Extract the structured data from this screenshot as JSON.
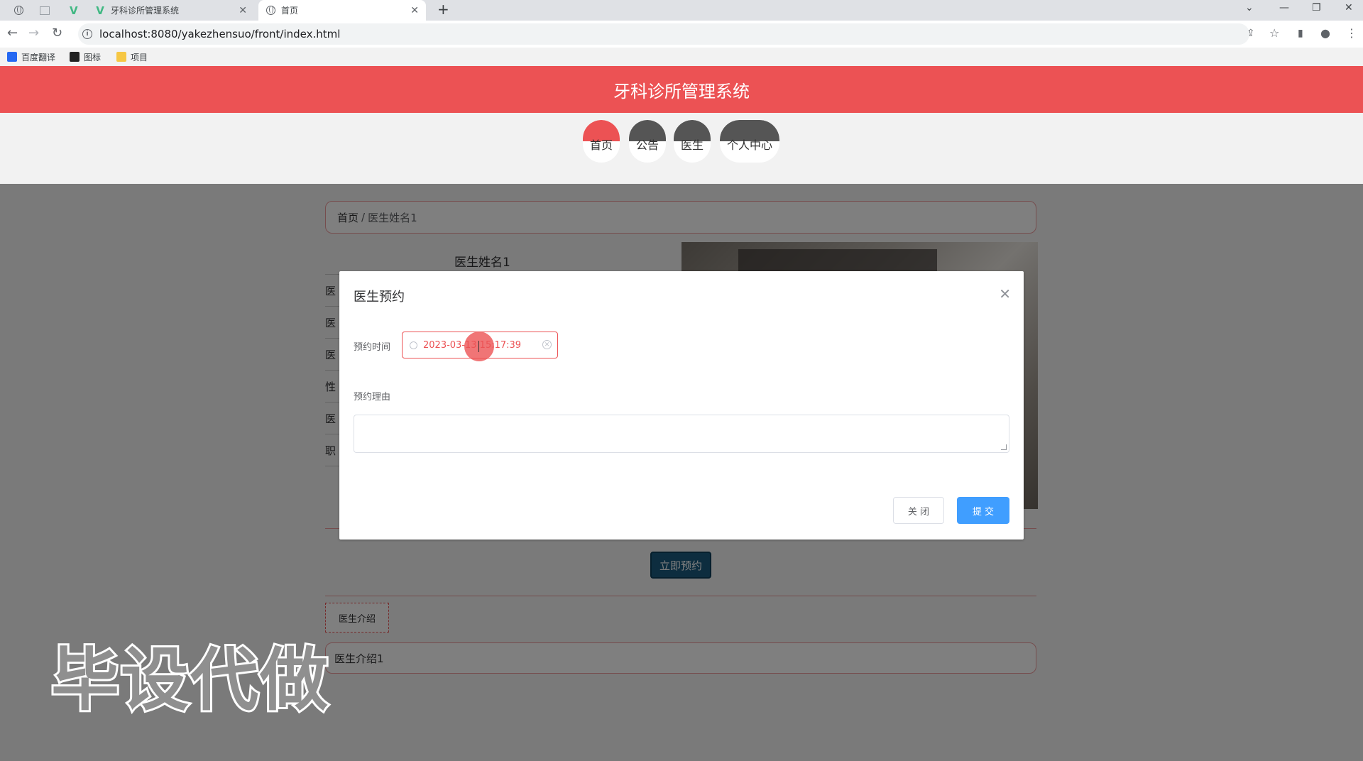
{
  "browser": {
    "tabs": [
      {
        "title": "牙科诊所管理系统"
      },
      {
        "title": "首页"
      }
    ],
    "url": "localhost:8080/yakezhensuo/front/index.html",
    "bookmarks": [
      "百度翻译",
      "图标",
      "项目"
    ]
  },
  "app": {
    "title": "牙科诊所管理系统",
    "menu": [
      {
        "label": "首页",
        "active": true
      },
      {
        "label": "公告"
      },
      {
        "label": "医生"
      },
      {
        "label": "个人中心"
      }
    ]
  },
  "breadcrumb": {
    "home": "首页",
    "separator": "/",
    "current": "医生姓名1"
  },
  "doctor": {
    "name": "医生姓名1",
    "field_labels_partial": [
      "医",
      "医",
      "医",
      "性",
      "医",
      "职"
    ],
    "book_button": "立即预约",
    "intro_tab": "医生介绍",
    "intro_text": "医生介绍1"
  },
  "dialog": {
    "title": "医生预约",
    "time_label": "预约时间",
    "time_value": "2023-03-13 15:17:39",
    "reason_label": "预约理由",
    "reason_value": "",
    "close_button": "关 闭",
    "submit_button": "提 交"
  },
  "watermark": "毕设代做",
  "colors": {
    "brand": "#ec5254",
    "primary": "#409eff",
    "book_button": "#1a5a7e"
  }
}
